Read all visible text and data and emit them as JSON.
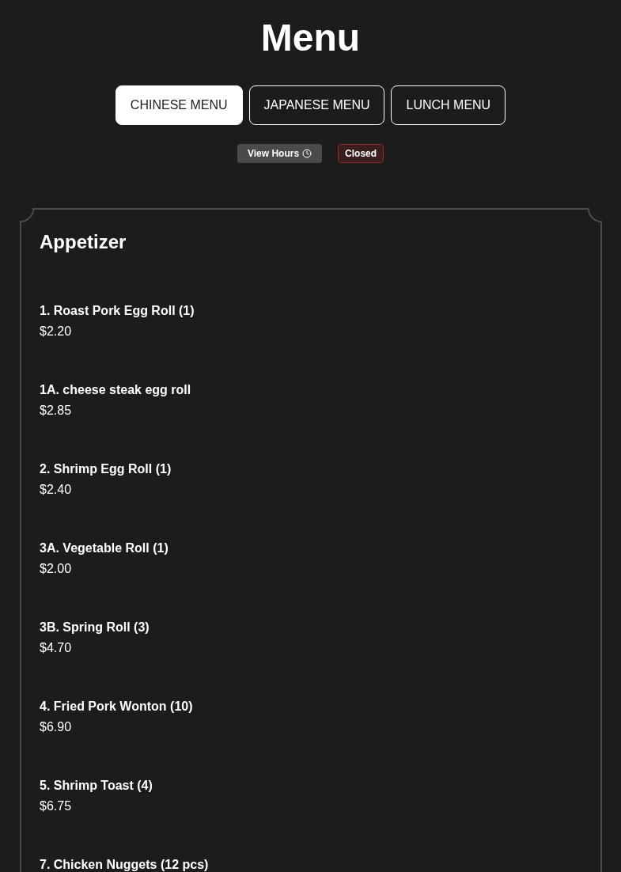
{
  "title": "Menu",
  "tabs": [
    {
      "label": "CHINESE MENU",
      "selected": true
    },
    {
      "label": "JAPANESE MENU",
      "selected": false
    },
    {
      "label": "LUNCH MENU",
      "selected": false
    }
  ],
  "hours_button": {
    "label": "View Hours"
  },
  "status": {
    "label": "Closed",
    "open": false
  },
  "sections": [
    {
      "title": "Appetizer",
      "items": [
        {
          "name": "1. Roast Pork Egg Roll (1)",
          "price": "$2.20"
        },
        {
          "name": "1A. cheese steak egg roll",
          "price": "$2.85"
        },
        {
          "name": "2. Shrimp Egg Roll (1)",
          "price": "$2.40"
        },
        {
          "name": "3A. Vegetable Roll (1)",
          "price": "$2.00"
        },
        {
          "name": "3B. Spring Roll (3)",
          "price": "$4.70"
        },
        {
          "name": "4. Fried Pork Wonton (10)",
          "price": "$6.90"
        },
        {
          "name": "5. Shrimp Toast (4)",
          "price": "$6.75"
        },
        {
          "name": "7. Chicken Nuggets (12 pcs)"
        }
      ]
    }
  ]
}
